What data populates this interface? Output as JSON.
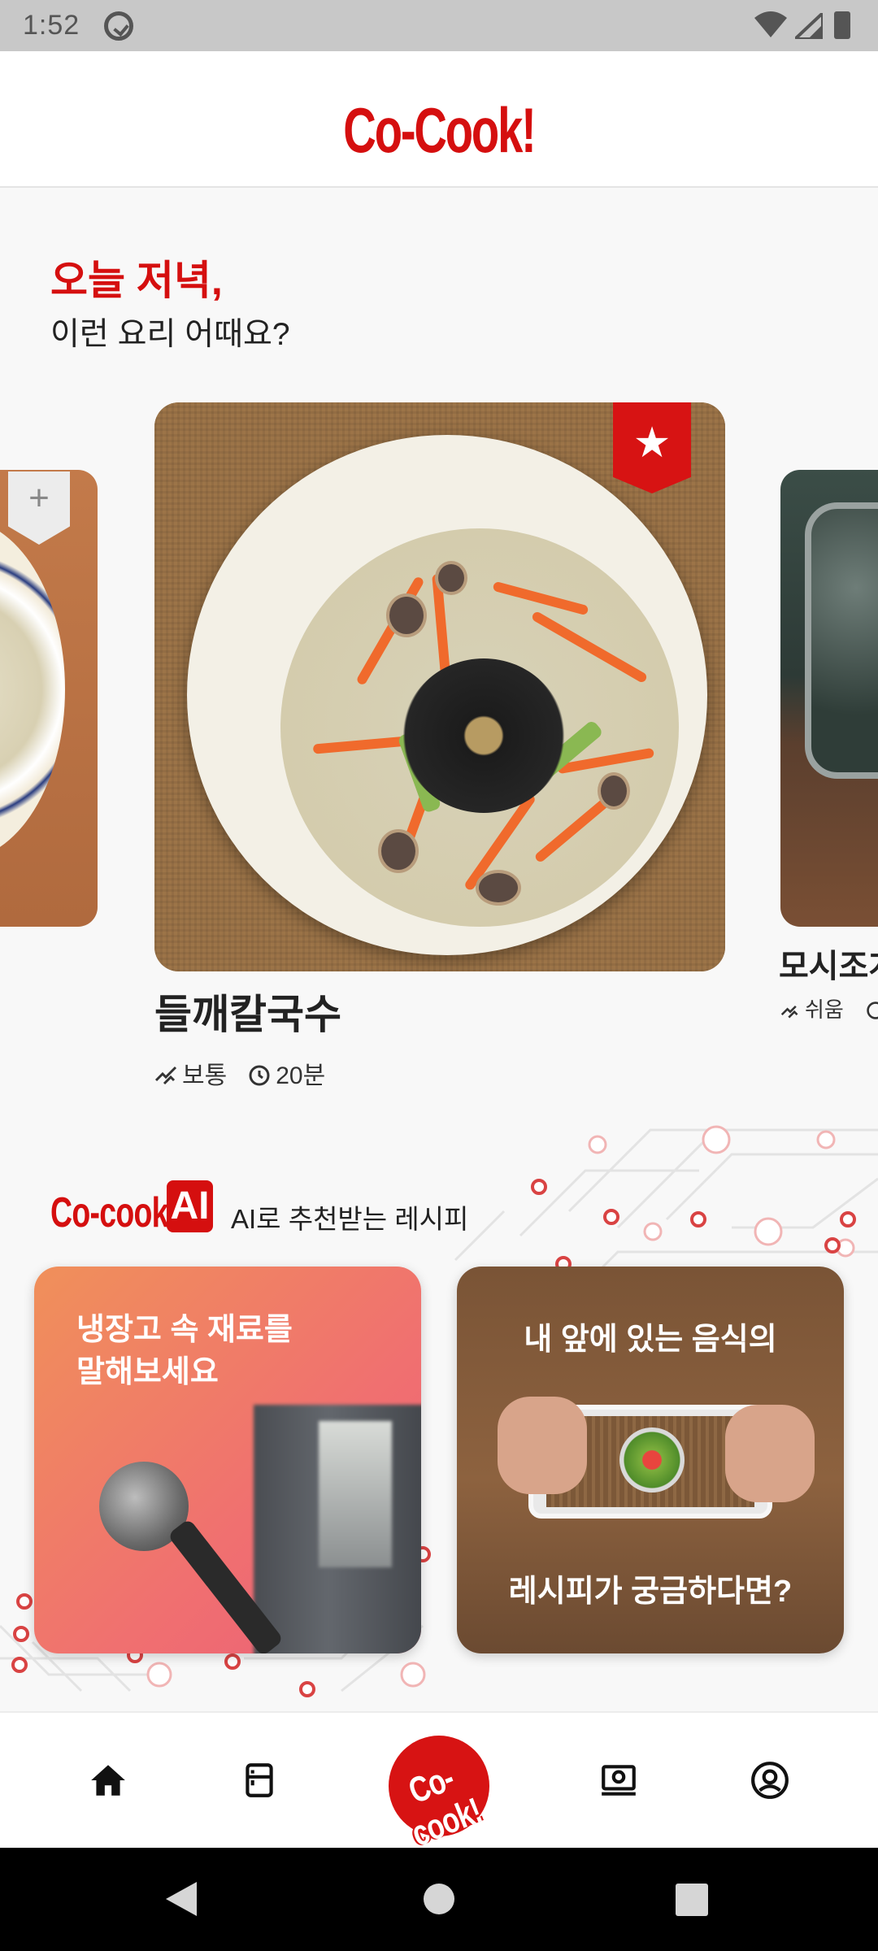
{
  "status_bar": {
    "time": "1:52"
  },
  "header": {
    "brand": "Co-Cook!"
  },
  "hero": {
    "title_line1": "오늘 저녁,",
    "title_line2": "이런 요리 어때요?",
    "featured": {
      "name": "들깨칼국수",
      "difficulty": "보통",
      "time": "20분"
    },
    "next": {
      "name": "모시조개",
      "difficulty": "쉬움"
    }
  },
  "ai_section": {
    "brand": "Co-cook!",
    "badge": "AI",
    "subtitle": "AI로 추천받는 레시피",
    "cards": [
      {
        "text_line1": "냉장고 속 재료를",
        "text_line2": "말해보세요"
      },
      {
        "text_top": "내 앞에 있는 음식의",
        "text_bottom": "레시피가 궁금하다면?"
      }
    ]
  },
  "bottom_nav": {
    "center_label": "Co-cook!"
  },
  "colors": {
    "brand_red": "#d50f0f",
    "background": "#f8f8f8"
  },
  "icons": [
    "home-icon",
    "fridge-icon",
    "watch-icon",
    "profile-icon",
    "star-icon",
    "plus-icon",
    "difficulty-icon",
    "clock-icon"
  ]
}
